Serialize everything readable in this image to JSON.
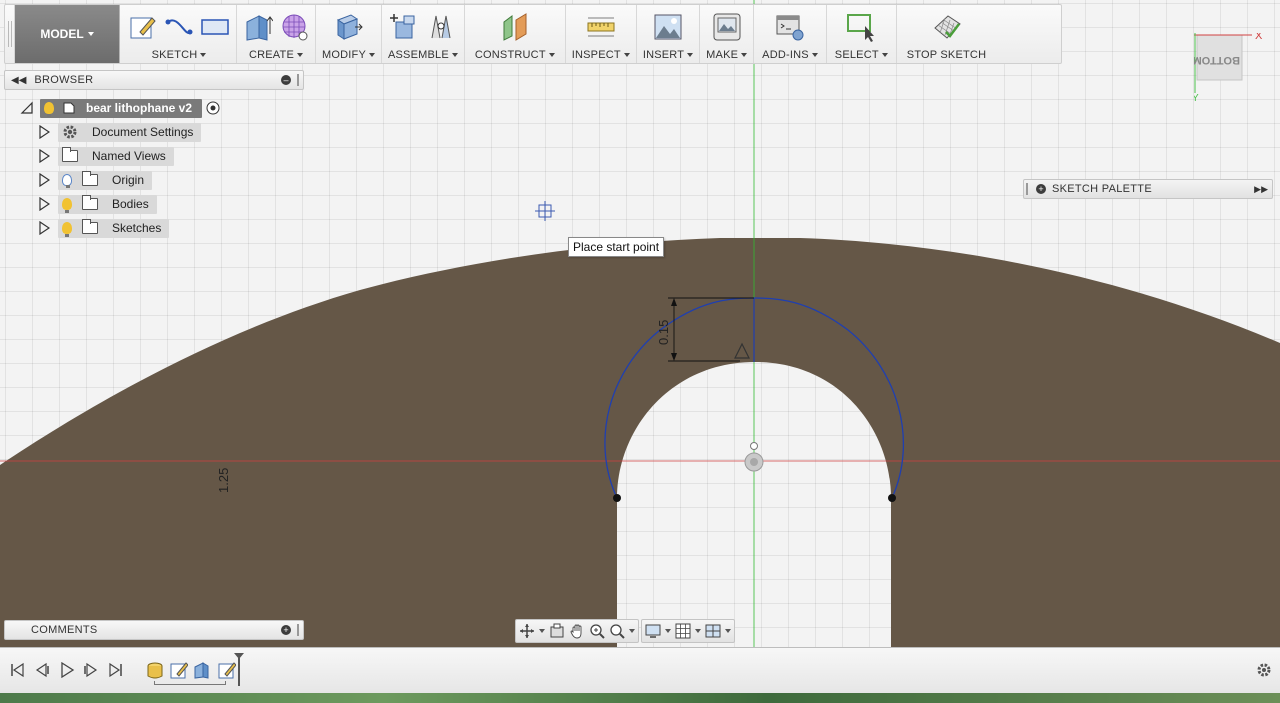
{
  "toolbar": {
    "workspace": "MODEL",
    "groups": [
      {
        "label": "SKETCH"
      },
      {
        "label": "CREATE"
      },
      {
        "label": "MODIFY"
      },
      {
        "label": "ASSEMBLE"
      },
      {
        "label": "CONSTRUCT"
      },
      {
        "label": "INSPECT"
      },
      {
        "label": "INSERT"
      },
      {
        "label": "MAKE"
      },
      {
        "label": "ADD-INS"
      },
      {
        "label": "SELECT"
      },
      {
        "label": "STOP SKETCH"
      }
    ]
  },
  "browser": {
    "title": "BROWSER",
    "root": "bear lithophane v2",
    "items": [
      {
        "label": "Document Settings",
        "icon": "gear-icon"
      },
      {
        "label": "Named Views",
        "icon": "folder-icon"
      },
      {
        "label": "Origin",
        "icon": "folder-icon",
        "bulb": "off"
      },
      {
        "label": "Bodies",
        "icon": "folder-icon",
        "bulb": "on"
      },
      {
        "label": "Sketches",
        "icon": "folder-icon",
        "bulb": "on"
      }
    ]
  },
  "comments": {
    "title": "COMMENTS"
  },
  "sketch_palette": {
    "title": "SKETCH PALETTE"
  },
  "tooltip": "Place start point",
  "viewcube": {
    "face": "BOTTOM",
    "axis_x": "X",
    "axis_y": "Y"
  },
  "dimensions": {
    "arc_gap": "0.15",
    "side": "1.25"
  },
  "colors": {
    "body": "#655747",
    "sketch_curve": "#1f3fb0",
    "x_axis": "#d04040",
    "y_axis": "#33bb33",
    "selection": "#3b5ab0"
  }
}
